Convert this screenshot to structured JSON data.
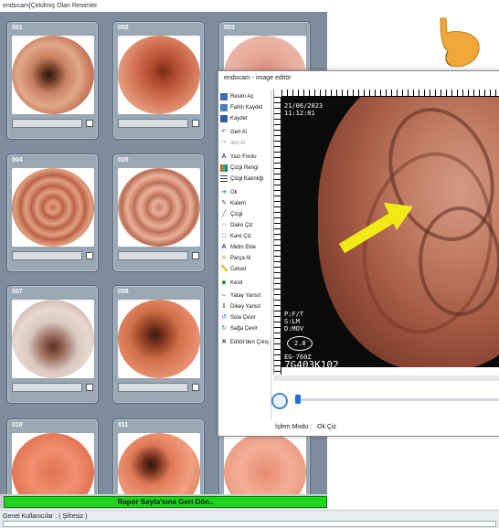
{
  "window": {
    "title": "endocam[Çekilmiş Olan Resimler"
  },
  "thumbnails": [
    {
      "num": "001"
    },
    {
      "num": "002"
    },
    {
      "num": "003"
    },
    {
      "num": "004"
    },
    {
      "num": "005"
    },
    {
      "num": "007"
    },
    {
      "num": "008"
    },
    {
      "num": "010"
    },
    {
      "num": "011"
    }
  ],
  "return_button": "Rapor Sayfa'sına Geri Dön..",
  "status": {
    "user": "Genel Kullanıcılar : ( Şifresiz )"
  },
  "editor": {
    "title": "endocam - image editör",
    "tools": [
      {
        "label": "Resim Aç",
        "icon": "open-image-icon"
      },
      {
        "label": "Farklı Kaydet",
        "icon": "save-as-icon"
      },
      {
        "label": "Kaydet",
        "icon": "save-icon"
      },
      {
        "label": "Geri Al",
        "icon": "undo-icon"
      },
      {
        "label": "İleri Al",
        "icon": "redo-icon"
      },
      {
        "label": "Yazı Fontu",
        "icon": "font-icon"
      },
      {
        "label": "Çizgi Rengi",
        "icon": "line-color-icon"
      },
      {
        "label": "Çizgi Kalınlığı",
        "icon": "line-width-icon"
      },
      {
        "label": "Ok",
        "icon": "arrow-icon"
      },
      {
        "label": "Kalem",
        "icon": "pen-icon"
      },
      {
        "label": "Çizgi",
        "icon": "line-icon"
      },
      {
        "label": "Daire Çiz",
        "icon": "circle-icon"
      },
      {
        "label": "Kare Çiz",
        "icon": "square-icon"
      },
      {
        "label": "Metin Ekle",
        "icon": "text-icon"
      },
      {
        "label": "Parça Al",
        "icon": "crop-icon"
      },
      {
        "label": "Cetvel",
        "icon": "ruler-icon"
      },
      {
        "label": "Kesit",
        "icon": "section-icon"
      },
      {
        "label": "Yatay Yansıt",
        "icon": "flip-horizontal-icon"
      },
      {
        "label": "Dikey Yansıt",
        "icon": "flip-vertical-icon"
      },
      {
        "label": "Sola Çevir",
        "icon": "rotate-left-icon"
      },
      {
        "label": "Sağa Çevir",
        "icon": "rotate-right-icon"
      },
      {
        "label": "Editör'den Çıkış",
        "icon": "exit-icon"
      }
    ],
    "overlay": {
      "date": "21/06/2023",
      "time": "11:12:01",
      "left_codes": [
        "P:F/T",
        "S:LM",
        "D:MOV"
      ],
      "dial_value": "2.8",
      "model": "EG-760Z",
      "serial": "7G403K102"
    },
    "mode_label": "İşlem Modu :",
    "mode_value": "Ok Çiz",
    "colors": {
      "arrow": "#f2ea16"
    }
  }
}
